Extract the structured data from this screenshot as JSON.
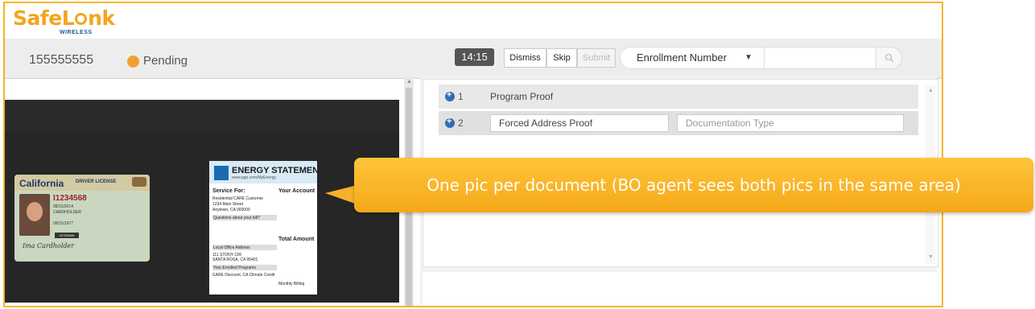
{
  "brand": {
    "name_pre": "Safe",
    "name_mid": "L",
    "name_post": "nk",
    "sub": "WIRELESS"
  },
  "header": {
    "account_number": "155555555",
    "status": "Pending",
    "status_color": "#f0a030"
  },
  "toolbar": {
    "timer": "14:15",
    "dismiss": "Dismiss",
    "skip": "Skip",
    "submit": "Submit",
    "search_by": "Enrollment Number",
    "search_value": ""
  },
  "documents": [
    {
      "index": "1",
      "label": "Program Proof"
    },
    {
      "index": "2",
      "field_value": "Forced Address Proof",
      "type_placeholder": "Documentation Type"
    }
  ],
  "id_card": {
    "state": "California",
    "type": "DRIVER LICENSE",
    "number": "I1234568",
    "exp": "08/31/2014",
    "name": "CARDHOLDER",
    "dob": "08/31/1977",
    "veteran": "VETERAN",
    "signature": "Ima Cardholder"
  },
  "statement": {
    "title": "ENERGY STATEMENT",
    "url": "www.pge.com/MyEnergy",
    "service_for": "Service For:",
    "customer": "Residential CARE Customer",
    "address1": "1234 Main Street",
    "address2": "Anytown, CA 000000",
    "account": "Your Account",
    "questions": "Questions about your bill?",
    "local_office": "Local Office Address",
    "office1": "111 STONY CIR",
    "office2": "SANTA ROSA, CA 95401",
    "programs": "Your Enrolled Programs",
    "programs_text": "CARE Discount, CA Climate Credit",
    "total": "Total Amount",
    "billing": "Monthly Billing"
  },
  "callout": {
    "text": "One pic per document (BO agent sees both pics in the same area)"
  },
  "colors": {
    "accent": "#f3b528",
    "callout": "#f7b02a",
    "plus": "#2e6fb0"
  }
}
